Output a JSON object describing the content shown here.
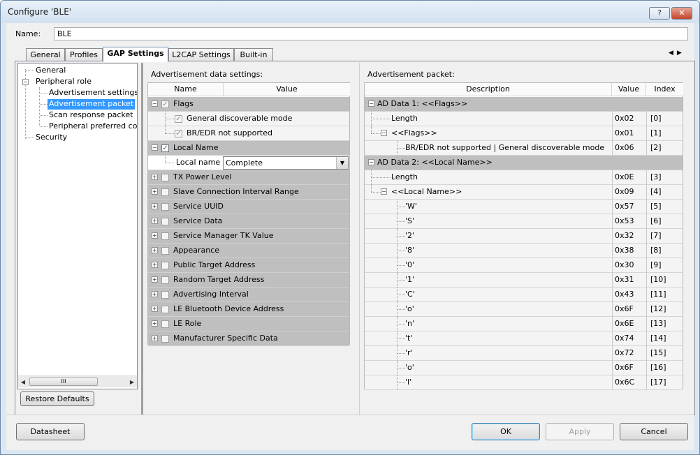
{
  "window": {
    "title": "Configure 'BLE'",
    "help_label": "?",
    "close_label": "✕"
  },
  "name_field": {
    "label": "Name:",
    "value": "BLE"
  },
  "tabs": [
    {
      "label": "General"
    },
    {
      "label": "Profiles"
    },
    {
      "label": "GAP Settings"
    },
    {
      "label": "L2CAP Settings"
    },
    {
      "label": "Built-in"
    }
  ],
  "tab_scroll": {
    "left": "◀",
    "right": "▶"
  },
  "tree": {
    "items": [
      "General",
      "Peripheral role",
      "Advertisement settings",
      "Advertisement packet",
      "Scan response packet",
      "Peripheral preferred conne",
      "Security"
    ],
    "expander": "−",
    "scroll_grip": "III",
    "scroll_left": "◀",
    "scroll_right": "▶"
  },
  "restore_button": "Restore Defaults",
  "adv_settings": {
    "title": "Advertisement data settings:",
    "col_name": "Name",
    "col_value": "Value",
    "check": "✓",
    "flags": {
      "label": "Flags",
      "children": [
        "General discoverable mode",
        "BR/EDR not supported"
      ]
    },
    "local_name": {
      "label": "Local Name",
      "child_label": "Local name",
      "child_value": "Complete",
      "dropdown_arrow": "▼"
    },
    "collapsed_items": [
      "TX Power Level",
      "Slave Connection Interval Range",
      "Service UUID",
      "Service Data",
      "Service Manager TK Value",
      "Appearance",
      "Public Target Address",
      "Random Target Address",
      "Advertising Interval",
      "LE Bluetooth Device Address",
      "LE Role",
      "Manufacturer Specific Data"
    ],
    "expand_plus": "+",
    "expand_minus": "−"
  },
  "adv_packet": {
    "title": "Advertisement packet:",
    "col_desc": "Description",
    "col_value": "Value",
    "col_index": "Index",
    "groups": [
      {
        "label": "AD Data 1: <<Flags>>",
        "rows": [
          {
            "desc": "Length",
            "value": "0x02",
            "index": "[0]"
          },
          {
            "desc": "<<Flags>>",
            "value": "0x01",
            "index": "[1]"
          },
          {
            "desc": "BR/EDR not supported | General discoverable mode",
            "value": "0x06",
            "index": "[2]"
          }
        ]
      },
      {
        "label": "AD Data 2: <<Local Name>>",
        "rows": [
          {
            "desc": "Length",
            "value": "0x0E",
            "index": "[3]"
          },
          {
            "desc": "<<Local Name>>",
            "value": "0x09",
            "index": "[4]"
          },
          {
            "desc": "'W'",
            "value": "0x57",
            "index": "[5]"
          },
          {
            "desc": "'S'",
            "value": "0x53",
            "index": "[6]"
          },
          {
            "desc": "'2'",
            "value": "0x32",
            "index": "[7]"
          },
          {
            "desc": "'8'",
            "value": "0x38",
            "index": "[8]"
          },
          {
            "desc": "'0'",
            "value": "0x30",
            "index": "[9]"
          },
          {
            "desc": "'1'",
            "value": "0x31",
            "index": "[10]"
          },
          {
            "desc": "'C'",
            "value": "0x43",
            "index": "[11]"
          },
          {
            "desc": "'o'",
            "value": "0x6F",
            "index": "[12]"
          },
          {
            "desc": "'n'",
            "value": "0x6E",
            "index": "[13]"
          },
          {
            "desc": "'t'",
            "value": "0x74",
            "index": "[14]"
          },
          {
            "desc": "'r'",
            "value": "0x72",
            "index": "[15]"
          },
          {
            "desc": "'o'",
            "value": "0x6F",
            "index": "[16]"
          },
          {
            "desc": "'l'",
            "value": "0x6C",
            "index": "[17]"
          }
        ]
      }
    ]
  },
  "footer": {
    "datasheet": "Datasheet",
    "ok": "OK",
    "apply": "Apply",
    "cancel": "Cancel"
  }
}
